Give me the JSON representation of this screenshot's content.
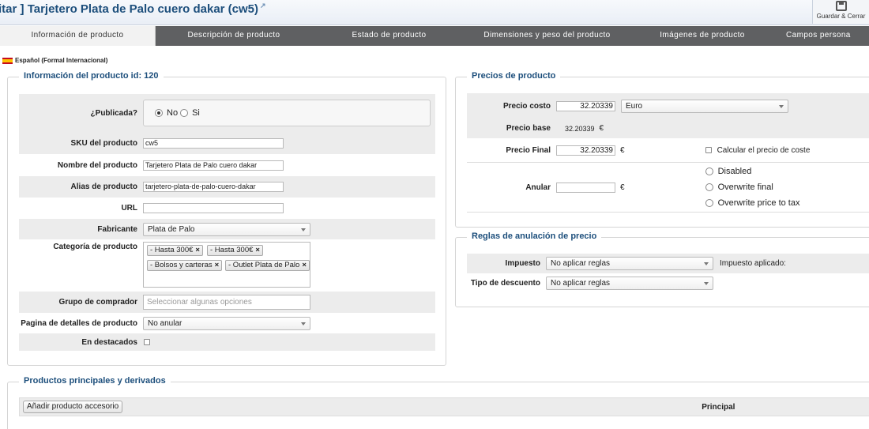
{
  "header": {
    "prefix": "itar ]",
    "title": "Tarjetero Plata de Palo cuero dakar (cw5)",
    "save_close": "Guardar & Cerrar"
  },
  "tabs": [
    {
      "label": "Información de producto"
    },
    {
      "label": "Descripción de producto"
    },
    {
      "label": "Estado de producto"
    },
    {
      "label": "Dimensiones y peso del producto"
    },
    {
      "label": "Imágenes de producto"
    },
    {
      "label": "Campos persona"
    }
  ],
  "language": "Español (Formal Internacional)",
  "product_info": {
    "legend": "Información del producto id: 120",
    "published_label": "¿Publicada?",
    "published_no": "No",
    "published_si": "Si",
    "published_value": "No",
    "sku_label": "SKU del producto",
    "sku_value": "cw5",
    "name_label": "Nombre del producto",
    "name_value": "Tarjetero Plata de Palo cuero dakar",
    "alias_label": "Alias de producto",
    "alias_value": "tarjetero-plata-de-palo-cuero-dakar",
    "url_label": "URL",
    "url_value": "",
    "manufacturer_label": "Fabricante",
    "manufacturer_value": "Plata de Palo",
    "category_label": "Categoría de producto",
    "categories": [
      "- Hasta 300€",
      "- Hasta 300€",
      "- Bolsos y carteras",
      "- Outlet Plata de Palo"
    ],
    "buyer_group_label": "Grupo de comprador",
    "buyer_group_placeholder": "Seleccionar algunas opciones",
    "details_page_label": "Pagina de detalles de producto",
    "details_page_value": "No anular",
    "featured_label": "En destacados",
    "featured_checked": false
  },
  "prices": {
    "legend": "Precios de producto",
    "cost_label": "Precio costo",
    "cost_value": "32.20339",
    "currency_value": "Euro",
    "base_label": "Precio base",
    "base_value": "32.20339",
    "currency_symbol": "€",
    "final_label": "Precio Final",
    "final_value": "32.20339",
    "calc_cost_label": "Calcular el precio de coste",
    "override_label": "Anular",
    "override_value": "",
    "override_options": [
      "Disabled",
      "Overwrite final",
      "Overwrite price to tax"
    ]
  },
  "price_rules": {
    "legend": "Reglas de anulación de precio",
    "tax_label": "Impuesto",
    "tax_value": "No aplicar reglas",
    "tax_applied_label": "Impuesto aplicado:",
    "discount_label": "Tipo de descuento",
    "discount_value": "No aplicar reglas"
  },
  "related": {
    "legend": "Productos principales y derivados",
    "add_button": "Añadir producto accesorio",
    "principal_header": "Principal"
  }
}
